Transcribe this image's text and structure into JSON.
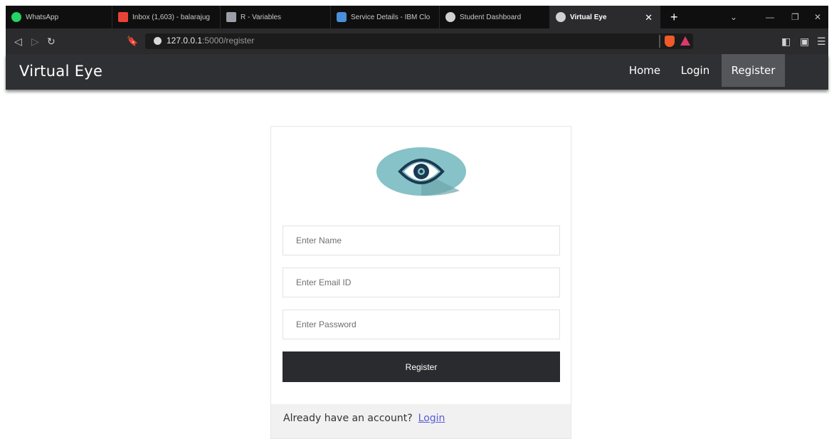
{
  "browser": {
    "tabs": [
      {
        "title": "WhatsApp",
        "favicon_color": "#25d366",
        "icon": "whatsapp-icon"
      },
      {
        "title": "Inbox (1,603) - balarajug",
        "favicon_color": "#ea4335",
        "icon": "gmail-icon"
      },
      {
        "title": "R - Variables",
        "favicon_color": "#9aa0a6",
        "icon": "r-icon"
      },
      {
        "title": "Service Details - IBM Clo",
        "favicon_color": "#4a90d9",
        "icon": "cloud-icon"
      },
      {
        "title": "Student Dashboard",
        "favicon_color": "#d0d0d0",
        "icon": "globe-icon"
      },
      {
        "title": "Virtual Eye",
        "favicon_color": "#d0d0d0",
        "icon": "globe-icon"
      }
    ],
    "active_tab_index": 5,
    "url_host": "127.0.0.1",
    "url_path": ":5000/register"
  },
  "site": {
    "brand": "Virtual Eye",
    "nav": [
      {
        "label": "Home"
      },
      {
        "label": "Login"
      },
      {
        "label": "Register"
      }
    ],
    "active_nav": "Register"
  },
  "form": {
    "name_placeholder": "Enter Name",
    "email_placeholder": "Enter Email ID",
    "password_placeholder": "Enter Password",
    "submit_label": "Register",
    "footer_text": "Already have an account?",
    "footer_link": "Login"
  },
  "colors": {
    "navbar": "#2f3033",
    "active_nav": "#55565a",
    "eye_background": "#86c2c7",
    "eye_iris": "#1b3a52",
    "button": "#2a2b2e",
    "link": "#5b5bd6"
  }
}
